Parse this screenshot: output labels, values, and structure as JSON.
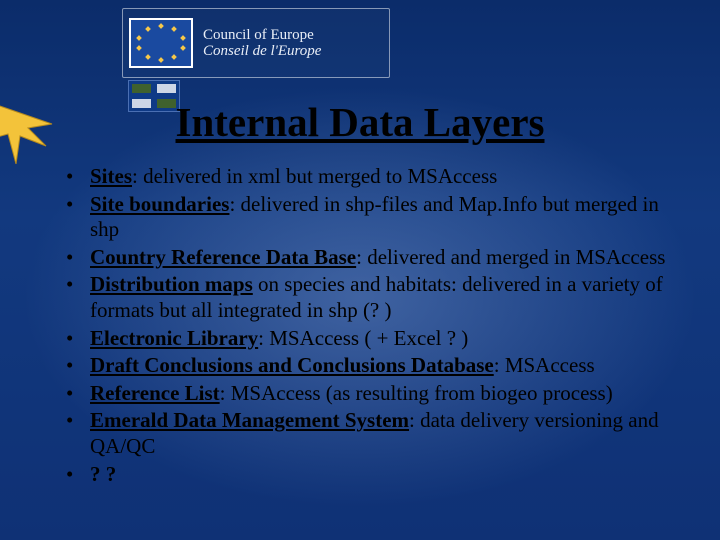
{
  "header": {
    "org_en": "Council of Europe",
    "org_fr": "Conseil de l'Europe"
  },
  "title": "Internal Data Layers",
  "bullets": [
    {
      "lead": "Sites",
      "rest": ": delivered in xml but merged to MSAccess"
    },
    {
      "lead": "Site boundaries",
      "rest": ": delivered in shp-files and Map.Info but merged in shp"
    },
    {
      "lead": "Country Reference Data Base",
      "rest": ": delivered and merged in MSAccess"
    },
    {
      "lead": "Distribution maps",
      "rest": " on species and habitats: delivered in a variety of formats but all integrated in shp (? )"
    },
    {
      "lead": "Electronic Library",
      "rest": ": MSAccess ( + Excel ? )"
    },
    {
      "lead": "Draft Conclusions and Conclusions Database",
      "rest": ": MSAccess"
    },
    {
      "lead": "Reference List",
      "rest": ": MSAccess (as resulting from biogeo process)"
    },
    {
      "lead": "Emerald Data Management System",
      "rest": ": data delivery versioning and QA/QC"
    },
    {
      "lead": "? ?",
      "rest": ""
    }
  ]
}
